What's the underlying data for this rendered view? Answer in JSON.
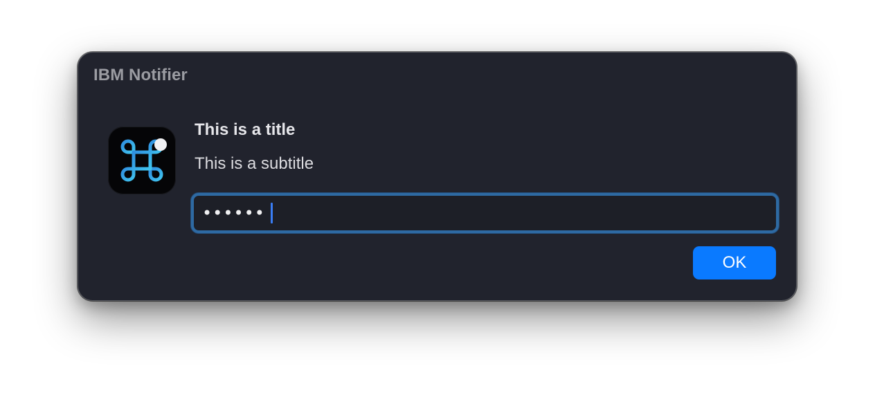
{
  "window": {
    "title": "IBM Notifier"
  },
  "icon": {
    "name": "command-key-icon",
    "badge": "notification-dot-icon",
    "colors": {
      "background": "#050507",
      "glyph_start": "#2f8fe0",
      "glyph_end": "#40c4ee",
      "badge": "#f2f2f4"
    }
  },
  "message": {
    "title": "This is a title",
    "subtitle": "This is a subtitle"
  },
  "secure_field": {
    "value": "••••••",
    "state": "focused"
  },
  "buttons": {
    "ok_label": "OK"
  },
  "colors": {
    "window_background": "#21232d",
    "accent": "#0a7aff",
    "focus_ring": "#2e6aa3"
  }
}
